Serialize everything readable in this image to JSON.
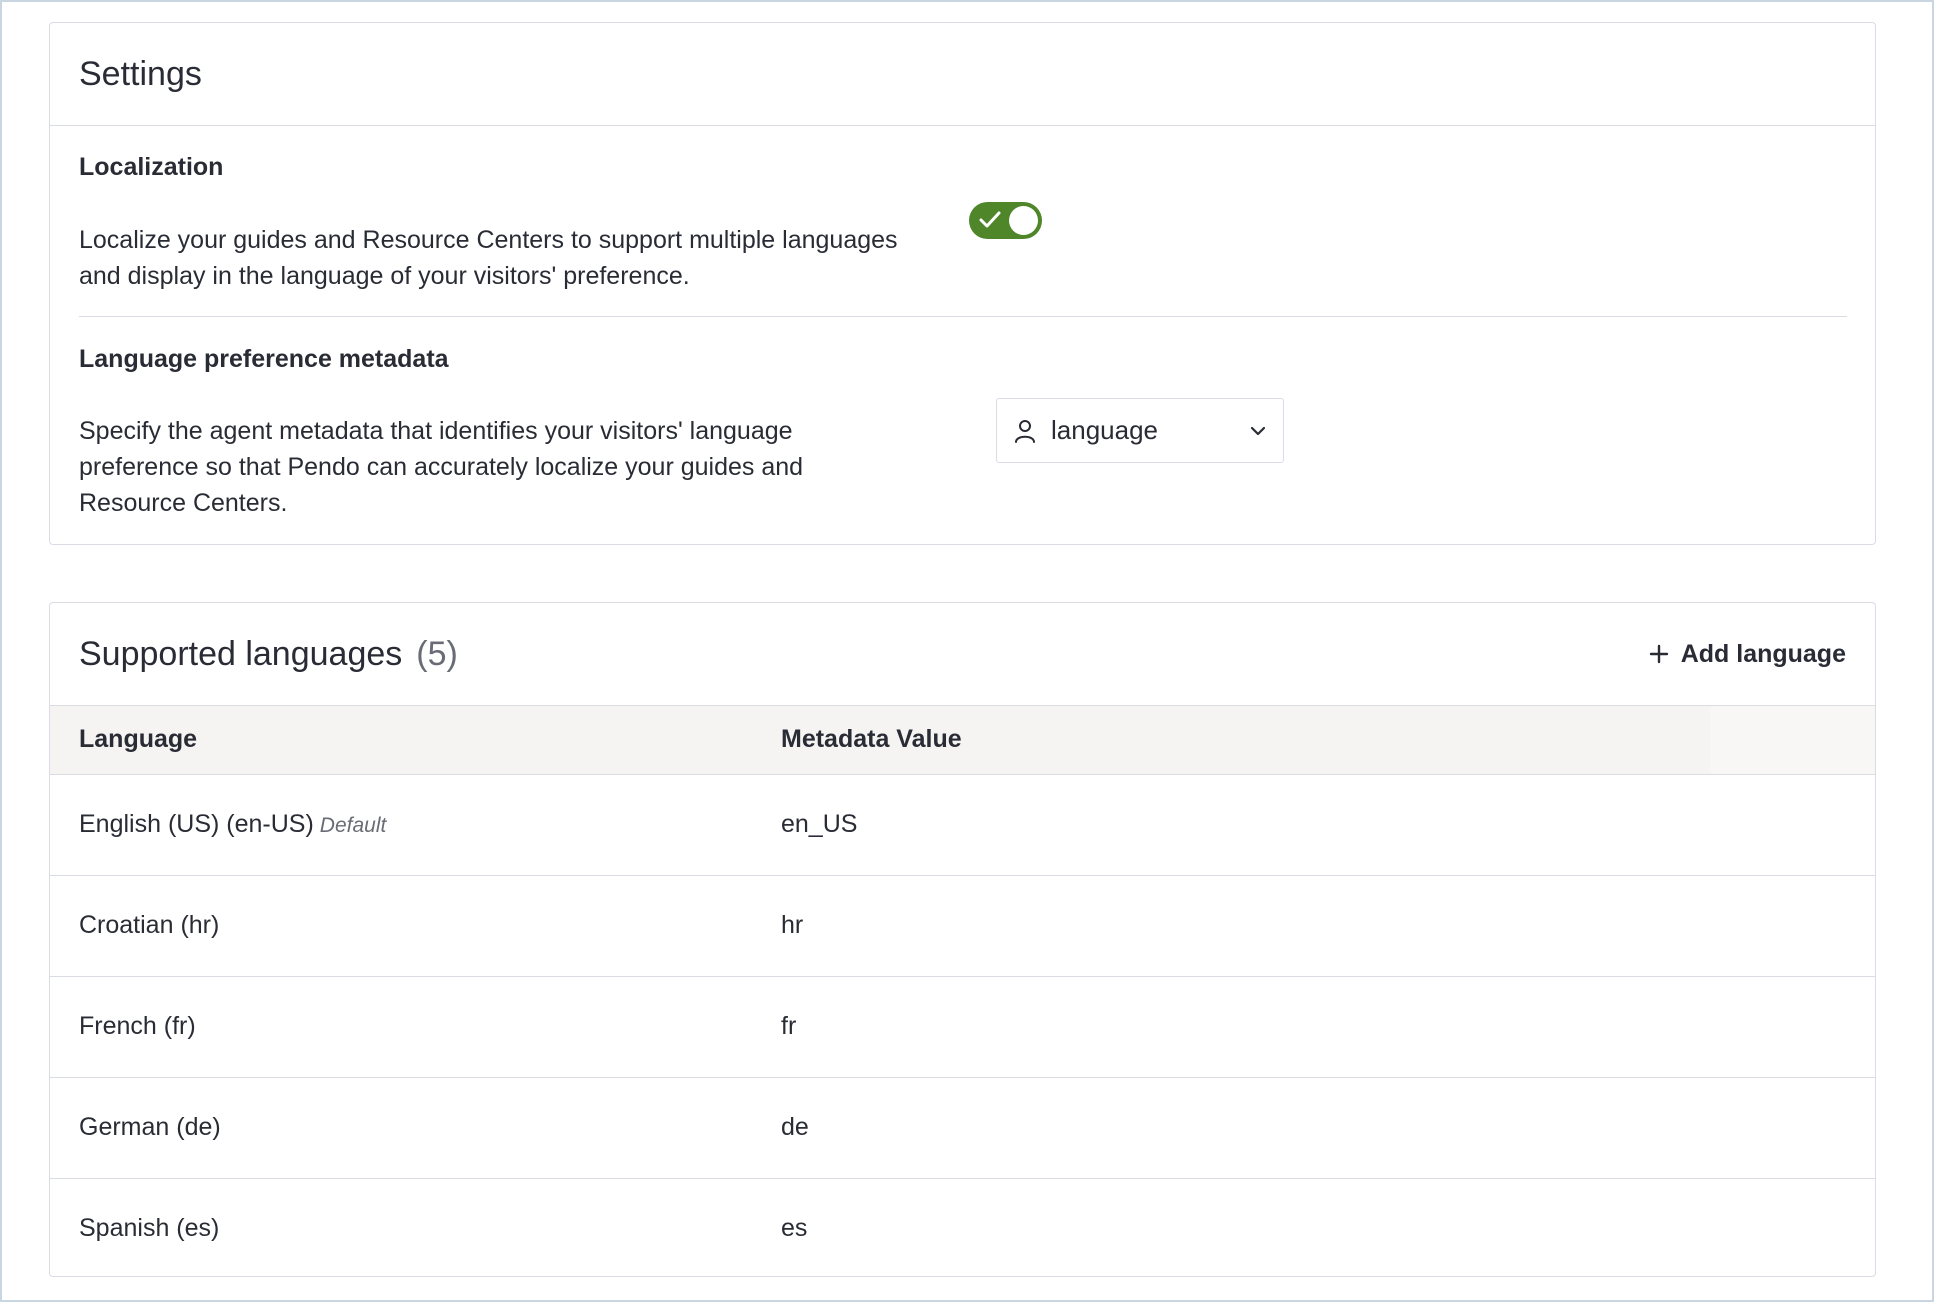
{
  "settings": {
    "title": "Settings",
    "localization": {
      "title": "Localization",
      "description_line1": "Localize your guides and Resource Centers to support multiple languages",
      "description_line2": "and display in the language of your visitors' preference.",
      "toggle_on": true,
      "toggle_color": "#4f8629"
    },
    "language_preference": {
      "title": "Language preference metadata",
      "description_line1": "Specify the agent metadata that identifies your visitors' language",
      "description_line2": "preference so that Pendo can accurately localize your guides and",
      "description_line3": "Resource Centers.",
      "select": {
        "icon": "user-icon",
        "value": "language",
        "chevron": "chevron-down-icon"
      }
    }
  },
  "languages": {
    "title": "Supported languages",
    "count": "(5)",
    "add_label": "Add language",
    "columns": [
      "Language",
      "Metadata Value"
    ],
    "rows": [
      {
        "language": "English (US) (en-US)",
        "tag": "Default",
        "value": "en_US"
      },
      {
        "language": "Croatian (hr)",
        "tag": "",
        "value": "hr"
      },
      {
        "language": "French (fr)",
        "tag": "",
        "value": "fr"
      },
      {
        "language": "German (de)",
        "tag": "",
        "value": "de"
      },
      {
        "language": "Spanish (es)",
        "tag": "",
        "value": "es"
      }
    ]
  }
}
